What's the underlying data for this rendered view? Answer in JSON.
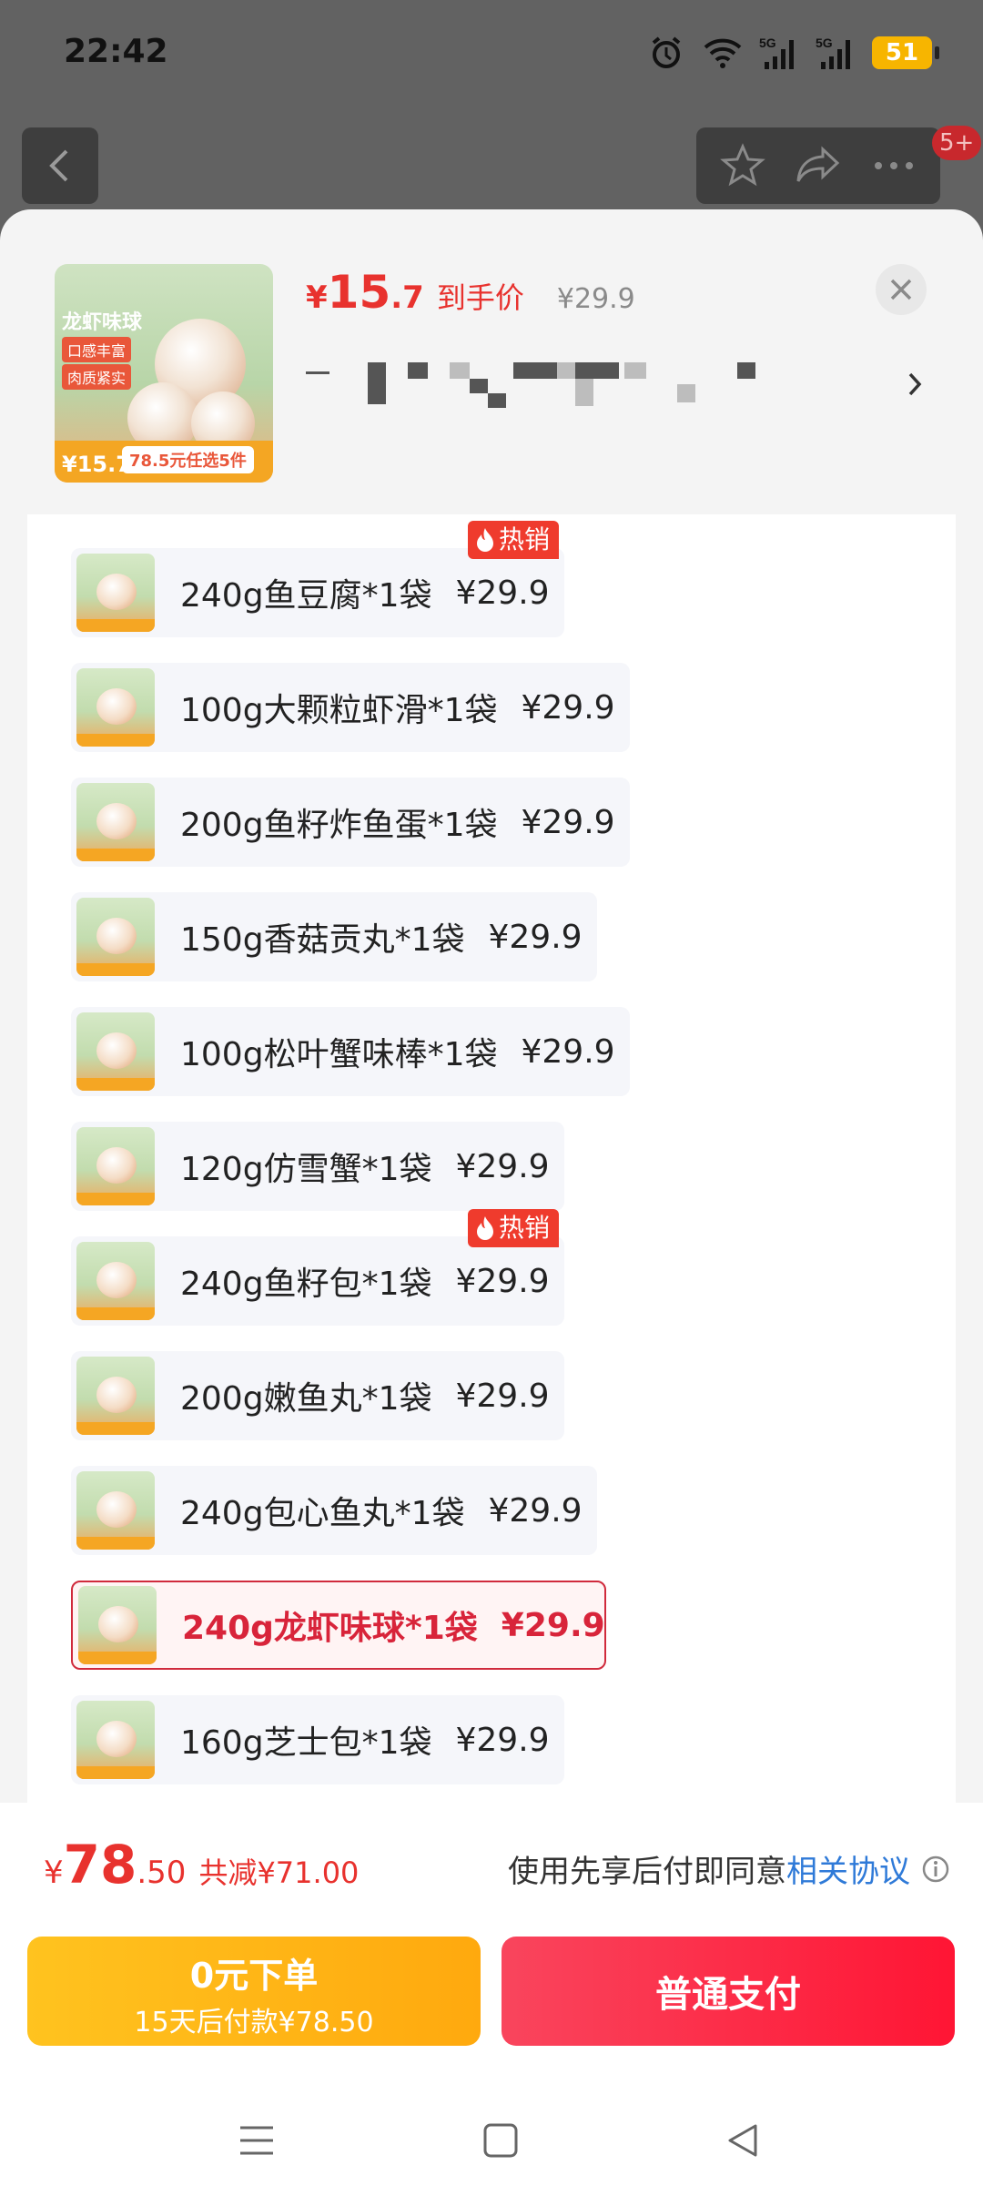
{
  "status_bar": {
    "time": "22:42",
    "battery": "51",
    "network1": "5G",
    "network2": "5G"
  },
  "topbar": {
    "message_badge": "5+"
  },
  "product": {
    "thumb_title": "龙虾味球",
    "thumb_tag1": "口感丰富",
    "thumb_tag2": "肉质紧实",
    "thumb_price": "¥15.7",
    "thumb_promo": "78.5元任选5件",
    "price_symbol": "¥",
    "price_int": "15",
    "price_dec": ".7",
    "price_label": "到手价",
    "original_price": "¥29.9"
  },
  "options": [
    {
      "label": "240g鱼豆腐*1袋",
      "price": "¥29.9",
      "hot": true
    },
    {
      "label": "100g大颗粒虾滑*1袋",
      "price": "¥29.9",
      "hot": false
    },
    {
      "label": "200g鱼籽炸鱼蛋*1袋",
      "price": "¥29.9",
      "hot": false
    },
    {
      "label": "150g香菇贡丸*1袋",
      "price": "¥29.9",
      "hot": false
    },
    {
      "label": "100g松叶蟹味棒*1袋",
      "price": "¥29.9",
      "hot": false
    },
    {
      "label": "120g仿雪蟹*1袋",
      "price": "¥29.9",
      "hot": false
    },
    {
      "label": "240g鱼籽包*1袋",
      "price": "¥29.9",
      "hot": true
    },
    {
      "label": "200g嫩鱼丸*1袋",
      "price": "¥29.9",
      "hot": false
    },
    {
      "label": "240g包心鱼丸*1袋",
      "price": "¥29.9",
      "hot": false
    },
    {
      "label": "240g龙虾味球*1袋",
      "price": "¥29.9",
      "hot": false,
      "selected": true
    },
    {
      "label": "160g芝士包*1袋",
      "price": "¥29.9",
      "hot": false
    }
  ],
  "hot_label": "热销",
  "summary": {
    "currency": "¥",
    "total_int": "78",
    "total_dec": ".50",
    "savings": "共减¥71.00",
    "agree_text": "使用先享后付即同意",
    "agree_link": "相关协议"
  },
  "buttons": {
    "pay_later_title": "0元下单",
    "pay_later_sub": "15天后付款¥78.50",
    "pay_now": "普通支付"
  },
  "colors": {
    "accent_red": "#e8322e",
    "selected_border": "#d02a3c",
    "pay_later": "#ffb716",
    "pay_now": "#ff2a45",
    "link": "#2f7ad8"
  }
}
